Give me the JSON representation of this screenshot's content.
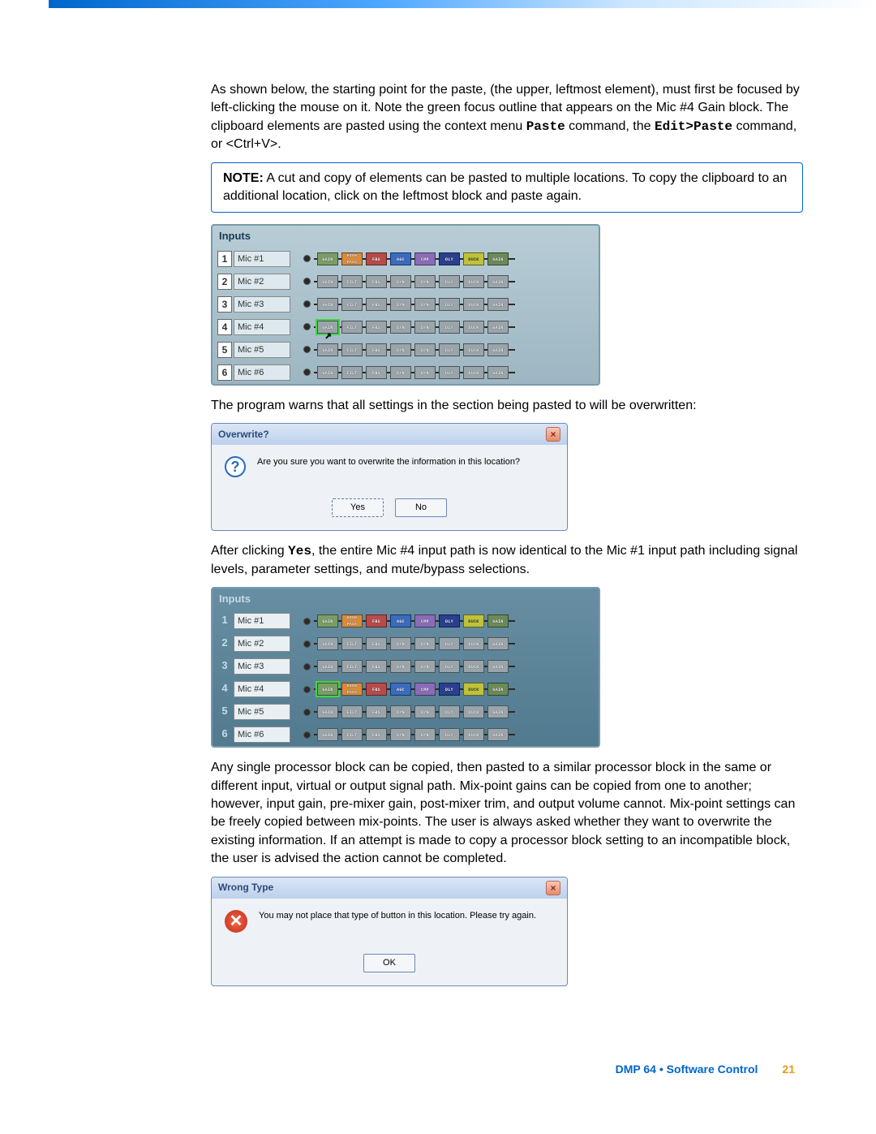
{
  "para1_a": "As shown below, the starting point for the paste, (the upper, leftmost element), must first be focused by left-clicking the mouse on it. Note the green focus outline that appears on the Mic #4 Gain block. The clipboard elements are pasted using the context menu ",
  "para1_paste": "Paste",
  "para1_b": " command, the ",
  "para1_edit": "Edit>Paste",
  "para1_c": " command, or <Ctrl+V>.",
  "note_label": "NOTE:",
  "note_text": "  A cut and copy of elements can be pasted to multiple locations. To copy the clipboard to an additional location, click on the leftmost block and paste again.",
  "panel1": {
    "head": "Inputs",
    "focus_row": 4,
    "rows": [
      {
        "n": "1",
        "label": "Mic #1",
        "blocks": [
          {
            "t": "GAIN",
            "c": "gain"
          },
          {
            "t": "HIGH PASS",
            "c": "hp"
          },
          {
            "t": "FBS",
            "c": "fbs"
          },
          {
            "t": "AGC",
            "c": "agc"
          },
          {
            "t": "CMP",
            "c": "cmp"
          },
          {
            "t": "DLY",
            "c": "dly"
          },
          {
            "t": "DUCK",
            "c": "duck"
          },
          {
            "t": "GAIN",
            "c": "gain2"
          }
        ]
      },
      {
        "n": "2",
        "label": "Mic #2",
        "blocks": [
          {
            "t": "GAIN",
            "c": "grey"
          },
          {
            "t": "FILT",
            "c": "grey"
          },
          {
            "t": "FBS",
            "c": "grey"
          },
          {
            "t": "DYN",
            "c": "grey"
          },
          {
            "t": "DYN",
            "c": "grey"
          },
          {
            "t": "DLY",
            "c": "grey"
          },
          {
            "t": "DUCK",
            "c": "grey"
          },
          {
            "t": "GAIN",
            "c": "grey"
          }
        ]
      },
      {
        "n": "3",
        "label": "Mic #3",
        "blocks": [
          {
            "t": "GAIN",
            "c": "grey"
          },
          {
            "t": "FILT",
            "c": "grey"
          },
          {
            "t": "FBS",
            "c": "grey"
          },
          {
            "t": "DYN",
            "c": "grey"
          },
          {
            "t": "DYN",
            "c": "grey"
          },
          {
            "t": "DLY",
            "c": "grey"
          },
          {
            "t": "DUCK",
            "c": "grey"
          },
          {
            "t": "GAIN",
            "c": "grey"
          }
        ]
      },
      {
        "n": "4",
        "label": "Mic #4",
        "blocks": [
          {
            "t": "GAIN",
            "c": "grey"
          },
          {
            "t": "FILT",
            "c": "grey"
          },
          {
            "t": "FBS",
            "c": "grey"
          },
          {
            "t": "DYN",
            "c": "grey"
          },
          {
            "t": "DYN",
            "c": "grey"
          },
          {
            "t": "DLY",
            "c": "grey"
          },
          {
            "t": "DUCK",
            "c": "grey"
          },
          {
            "t": "GAIN",
            "c": "grey"
          }
        ]
      },
      {
        "n": "5",
        "label": "Mic #5",
        "blocks": [
          {
            "t": "GAIN",
            "c": "grey"
          },
          {
            "t": "FILT",
            "c": "grey"
          },
          {
            "t": "FBS",
            "c": "grey"
          },
          {
            "t": "DYN",
            "c": "grey"
          },
          {
            "t": "DYN",
            "c": "grey"
          },
          {
            "t": "DLY",
            "c": "grey"
          },
          {
            "t": "DUCK",
            "c": "grey"
          },
          {
            "t": "GAIN",
            "c": "grey"
          }
        ]
      },
      {
        "n": "6",
        "label": "Mic #6",
        "blocks": [
          {
            "t": "GAIN",
            "c": "grey"
          },
          {
            "t": "FILT",
            "c": "grey"
          },
          {
            "t": "FBS",
            "c": "grey"
          },
          {
            "t": "DYN",
            "c": "grey"
          },
          {
            "t": "DYN",
            "c": "grey"
          },
          {
            "t": "DLY",
            "c": "grey"
          },
          {
            "t": "DUCK",
            "c": "grey"
          },
          {
            "t": "GAIN",
            "c": "grey"
          }
        ]
      }
    ]
  },
  "para2": "The program warns that all settings in the section being pasted to will be overwritten:",
  "dlg1": {
    "title": "Overwrite?",
    "msg": "Are you sure you want to overwrite the information in this location?",
    "yes": "Yes",
    "no": "No"
  },
  "para3_a": "After clicking ",
  "para3_yes": "Yes",
  "para3_b": ", the entire Mic #4 input path is now identical to the Mic #1 input path including signal levels, parameter settings, and mute/bypass selections.",
  "panel2": {
    "head": "Inputs",
    "focus_row": 4,
    "rows": [
      {
        "n": "1",
        "label": "Mic #1",
        "blocks": [
          {
            "t": "GAIN",
            "c": "gain"
          },
          {
            "t": "HIGH PASS",
            "c": "hp"
          },
          {
            "t": "FBS",
            "c": "fbs"
          },
          {
            "t": "AGC",
            "c": "agc"
          },
          {
            "t": "CMP",
            "c": "cmp"
          },
          {
            "t": "DLY",
            "c": "dly"
          },
          {
            "t": "DUCK",
            "c": "duck"
          },
          {
            "t": "GAIN",
            "c": "gain2"
          }
        ]
      },
      {
        "n": "2",
        "label": "Mic #2",
        "blocks": [
          {
            "t": "GAIN",
            "c": "grey"
          },
          {
            "t": "FILT",
            "c": "grey"
          },
          {
            "t": "FBS",
            "c": "grey"
          },
          {
            "t": "DYN",
            "c": "grey"
          },
          {
            "t": "DYN",
            "c": "grey"
          },
          {
            "t": "DLY",
            "c": "grey"
          },
          {
            "t": "DUCK",
            "c": "grey"
          },
          {
            "t": "GAIN",
            "c": "grey"
          }
        ]
      },
      {
        "n": "3",
        "label": "Mic #3",
        "blocks": [
          {
            "t": "GAIN",
            "c": "grey"
          },
          {
            "t": "FILT",
            "c": "grey"
          },
          {
            "t": "FBS",
            "c": "grey"
          },
          {
            "t": "DYN",
            "c": "grey"
          },
          {
            "t": "DYN",
            "c": "grey"
          },
          {
            "t": "DLY",
            "c": "grey"
          },
          {
            "t": "DUCK",
            "c": "grey"
          },
          {
            "t": "GAIN",
            "c": "grey"
          }
        ]
      },
      {
        "n": "4",
        "label": "Mic #4",
        "blocks": [
          {
            "t": "GAIN",
            "c": "gain"
          },
          {
            "t": "HIGH PASS",
            "c": "hp"
          },
          {
            "t": "FBS",
            "c": "fbs"
          },
          {
            "t": "AGC",
            "c": "agc"
          },
          {
            "t": "CMP",
            "c": "cmp"
          },
          {
            "t": "DLY",
            "c": "dly"
          },
          {
            "t": "DUCK",
            "c": "duck"
          },
          {
            "t": "GAIN",
            "c": "gain2"
          }
        ]
      },
      {
        "n": "5",
        "label": "Mic #5",
        "blocks": [
          {
            "t": "GAIN",
            "c": "grey"
          },
          {
            "t": "FILT",
            "c": "grey"
          },
          {
            "t": "FBS",
            "c": "grey"
          },
          {
            "t": "DYN",
            "c": "grey"
          },
          {
            "t": "DYN",
            "c": "grey"
          },
          {
            "t": "DLY",
            "c": "grey"
          },
          {
            "t": "DUCK",
            "c": "grey"
          },
          {
            "t": "GAIN",
            "c": "grey"
          }
        ]
      },
      {
        "n": "6",
        "label": "Mic #6",
        "blocks": [
          {
            "t": "GAIN",
            "c": "grey"
          },
          {
            "t": "FILT",
            "c": "grey"
          },
          {
            "t": "FBS",
            "c": "grey"
          },
          {
            "t": "DYN",
            "c": "grey"
          },
          {
            "t": "DYN",
            "c": "grey"
          },
          {
            "t": "DLY",
            "c": "grey"
          },
          {
            "t": "DUCK",
            "c": "grey"
          },
          {
            "t": "GAIN",
            "c": "grey"
          }
        ]
      }
    ]
  },
  "para4": "Any single processor block can be copied, then pasted to a similar processor block in the same or different input, virtual or output signal path. Mix-point gains can be copied from one to another; however, input gain, pre-mixer gain, post-mixer trim, and output volume cannot. Mix-point settings can be freely copied between mix-points. The user is always asked whether they want to overwrite the existing information. If an attempt is made to copy a processor block setting to an incompatible block, the user is advised the action cannot be completed.",
  "dlg2": {
    "title": "Wrong Type",
    "msg": "You may not place that type of button in this location.  Please try again.",
    "ok": "OK"
  },
  "footer": {
    "section": "DMP 64 • Software Control",
    "page": "21"
  }
}
